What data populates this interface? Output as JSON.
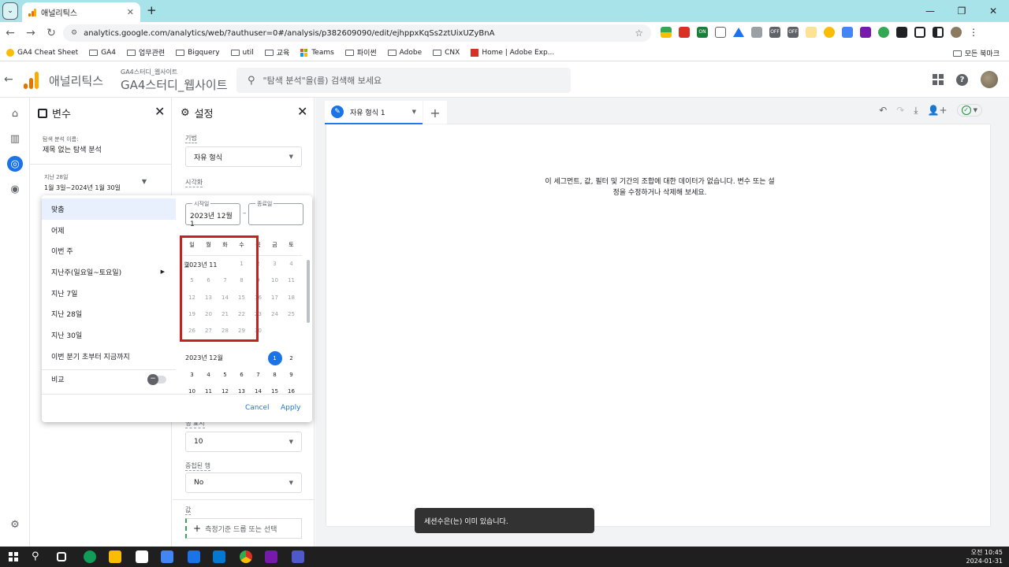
{
  "browser": {
    "tab_title": "애널리틱스",
    "url": "analytics.google.com/analytics/web/?authuser=0#/analysis/p382609090/edit/ejhppxKqSs2ztUixUZyBnA",
    "bookmarks": [
      "GA4 Cheat Sheet",
      "GA4",
      "업무관련",
      "Bigquery",
      "util",
      "교육",
      "Teams",
      "파이썬",
      "Adobe",
      "CNX",
      "Home | Adobe Exp..."
    ],
    "bookmarks_all": "모든 북마크",
    "extension_badges": [
      "ON",
      "OFF",
      "OFF"
    ]
  },
  "ga": {
    "app_name": "애널리틱스",
    "property_small": "GA4스터디_웹사이트",
    "property_big": "GA4스터디_웹사이트",
    "search_placeholder": "\"탐색 분석\"을(를) 검색해 보세요"
  },
  "variables": {
    "title": "변수",
    "exploration_label": "탐색 분석 이름:",
    "exploration_name": "제목 없는 탐색 분석",
    "date_range_label": "지난 28일",
    "date_range_value": "1월 3일~2024년 1월 30일"
  },
  "settings": {
    "title": "설정",
    "technique_label": "기법",
    "technique_value": "자유 형식",
    "visualization_label": "시각화",
    "rows_show_label": "행 표시",
    "rows_show_value": "10",
    "nested_rows_label": "중첩된 행",
    "nested_rows_value": "No",
    "values_label": "값",
    "metric_drop": "측정기준 드롭 또는 선택"
  },
  "date_picker": {
    "presets": [
      "맞춤",
      "어제",
      "이번 주",
      "지난주(일요일~토요일)",
      "지난 7일",
      "지난 28일",
      "지난 30일",
      "이번 분기 초부터 지금까지"
    ],
    "compare_label": "비교",
    "start_label": "시작일",
    "start_value": "2023년 12월 1",
    "end_label": "종료일",
    "end_value": "",
    "weekdays": [
      "일",
      "월",
      "화",
      "수",
      "목",
      "금",
      "토"
    ],
    "month1": "2023년 11",
    "month1_overlay": "월",
    "month1_rows": [
      [
        "",
        "",
        "",
        "1",
        "2",
        "3",
        "4"
      ],
      [
        "5",
        "6",
        "7",
        "8",
        "9",
        "10",
        "11"
      ],
      [
        "12",
        "13",
        "14",
        "15",
        "16",
        "17",
        "18"
      ],
      [
        "19",
        "20",
        "21",
        "22",
        "23",
        "24",
        "25"
      ],
      [
        "26",
        "27",
        "28",
        "29",
        "30",
        "",
        ""
      ]
    ],
    "month2": "2023년 12월",
    "month2_first_row": [
      "1",
      "2"
    ],
    "month2_rows": [
      [
        "3",
        "4",
        "5",
        "6",
        "7",
        "8",
        "9"
      ],
      [
        "10",
        "11",
        "12",
        "13",
        "14",
        "15",
        "16"
      ]
    ],
    "cancel": "Cancel",
    "apply": "Apply"
  },
  "canvas": {
    "tab_label": "자유 형식 1",
    "empty_line1": "이 세그먼트, 값, 필터 및 기간의 조합에 대한 데이터가 없습니다. 변수 또는 설",
    "empty_line2": "정을 수정하거나 삭제해 보세요."
  },
  "toast": "세션수은(는) 이미 있습니다.",
  "taskbar": {
    "time": "오전 10:45",
    "date": "2024-01-31"
  },
  "colors": {
    "accent": "#1a73e8",
    "highlight_box": "#c5221f",
    "tabstrip": "#a7e3e8"
  }
}
